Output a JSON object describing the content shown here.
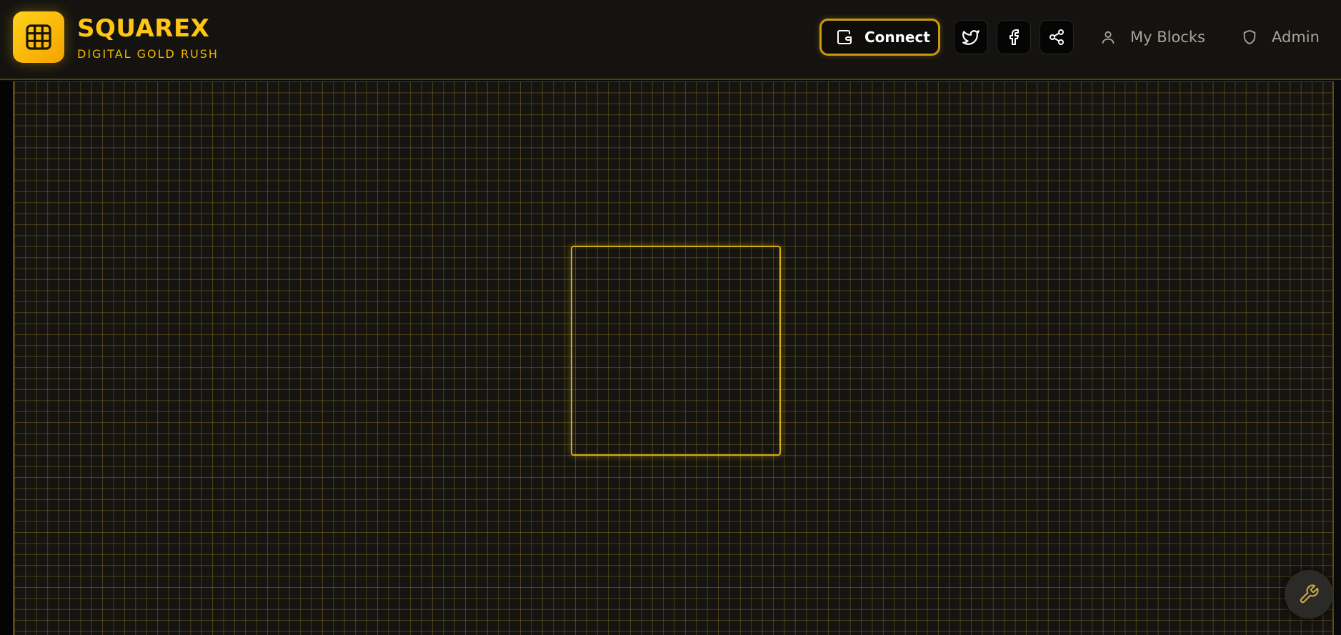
{
  "brand": {
    "title": "SQUAREX",
    "subtitle": "DIGITAL GOLD RUSH",
    "logo_icon": "grid-icon"
  },
  "header": {
    "connect_label": "Connect",
    "connect_icon": "wallet-icon",
    "social": [
      {
        "icon": "twitter-icon"
      },
      {
        "icon": "facebook-icon"
      },
      {
        "icon": "share-icon"
      }
    ],
    "nav": [
      {
        "label": "My Blocks",
        "icon": "user-icon"
      },
      {
        "label": "Admin",
        "icon": "shield-icon"
      }
    ]
  },
  "tools": {
    "icon": "wrench-icon"
  },
  "colors": {
    "accent": "#ffc414",
    "accent_dark": "#c99a10",
    "background": "#141310",
    "grid_line": "#78641e"
  }
}
